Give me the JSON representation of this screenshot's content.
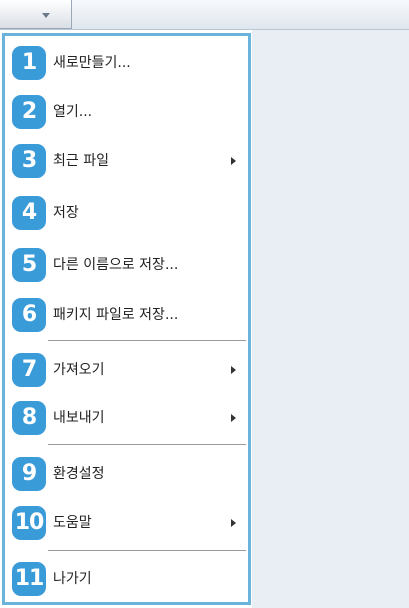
{
  "menu": {
    "items": [
      {
        "num": "1",
        "label": "새로만들기..."
      },
      {
        "num": "2",
        "label": "열기..."
      },
      {
        "num": "3",
        "label": "최근 파일",
        "submenu": true
      },
      {
        "num": "4",
        "label": "저장"
      },
      {
        "num": "5",
        "label": "다른 이름으로 저장..."
      },
      {
        "num": "6",
        "label": "패키지 파일로 저장..."
      },
      {
        "num": "7",
        "label": "가져오기",
        "submenu": true
      },
      {
        "num": "8",
        "label": "내보내기",
        "submenu": true
      },
      {
        "num": "9",
        "label": "환경설정"
      },
      {
        "num": "10",
        "label": "도움말",
        "submenu": true
      },
      {
        "num": "11",
        "label": "나가기"
      }
    ]
  },
  "colors": {
    "badge": "#3a9bd9",
    "menu_border": "#6ab4dc",
    "right_pane": "#e9eef5"
  }
}
